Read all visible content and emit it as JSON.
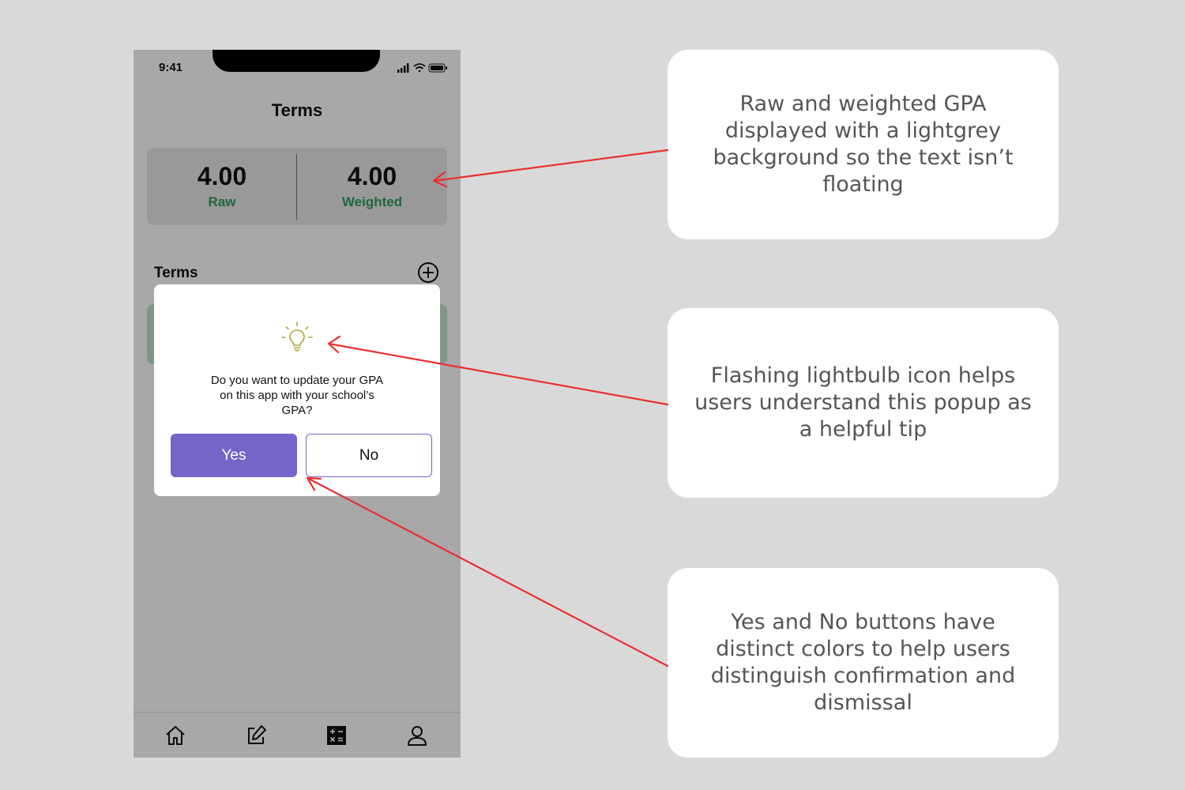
{
  "status_bar": {
    "time": "9:41"
  },
  "header": {
    "title": "Terms"
  },
  "gpa": {
    "raw_value": "4.00",
    "raw_label": "Raw",
    "weighted_value": "4.00",
    "weighted_label": "Weighted"
  },
  "terms_section": {
    "title": "Terms"
  },
  "dialog": {
    "message": "Do you want to update your GPA on this app with your school’s GPA?",
    "yes_label": "Yes",
    "no_label": "No"
  },
  "tab_bar": {
    "items": [
      "home-icon",
      "edit-icon",
      "calculator-icon",
      "profile-icon"
    ]
  },
  "annotations": [
    "Raw and weighted GPA displayed with a lightgrey background so the text isn’t floating",
    "Flashing lightbulb icon helps users understand this popup as a helpful tip",
    "Yes and No buttons have distinct colors to help users distinguish confirmation and dismissal"
  ],
  "colors": {
    "page_background": "#d9d9d9",
    "accent_purple": "#7466c8",
    "gpa_label_green": "#2e9e5b",
    "arrow_red": "#e8302e",
    "bulb_olive": "#b3a53a"
  }
}
